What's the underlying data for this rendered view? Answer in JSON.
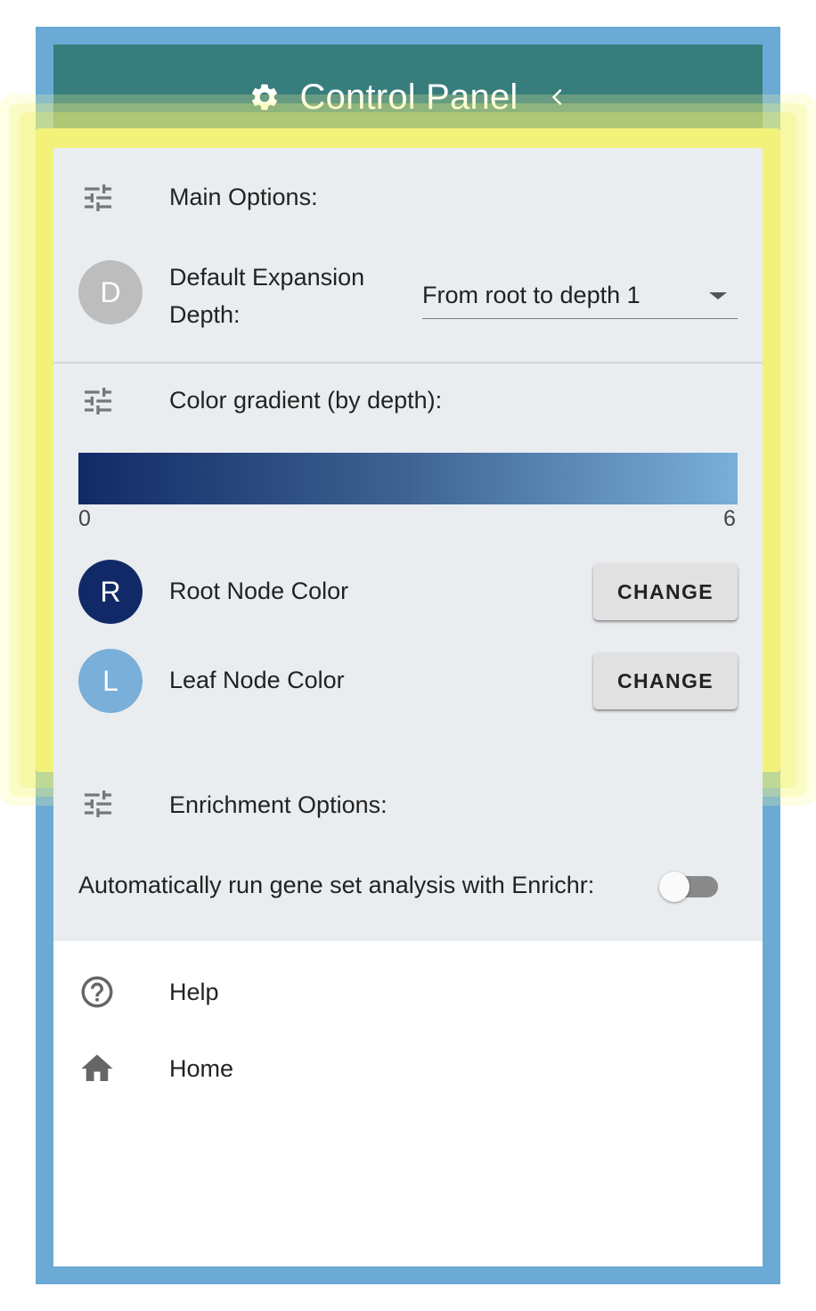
{
  "header": {
    "title": "Control Panel",
    "icon": "gear-icon",
    "collapse_icon": "chevron-left-icon",
    "bg_color": "#377d7b"
  },
  "main_options": {
    "heading": "Main Options:",
    "icon": "tune-icon",
    "expansion": {
      "avatar_letter": "D",
      "label_line1": "Default Expansion",
      "label_line2": "Depth:",
      "selected": "From root to depth 1"
    }
  },
  "color_gradient": {
    "heading": "Color gradient (by depth):",
    "min_label": "0",
    "max_label": "6",
    "start_color": "#112a67",
    "end_color": "#79afd8",
    "root": {
      "letter": "R",
      "label": "Root Node Color",
      "button": "CHANGE",
      "color": "#112a67"
    },
    "leaf": {
      "letter": "L",
      "label": "Leaf Node Color",
      "button": "CHANGE",
      "color": "#79afd8"
    }
  },
  "enrichment": {
    "heading": "Enrichment Options:",
    "toggle_label": "Automatically run gene set analysis with Enrichr:",
    "toggle_on": false
  },
  "nav": {
    "help": "Help",
    "home": "Home"
  }
}
